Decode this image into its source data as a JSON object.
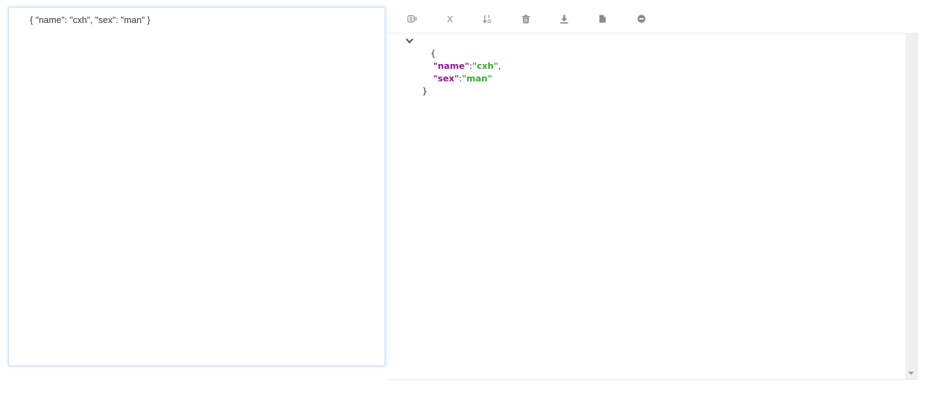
{
  "input": {
    "text": "{ \"name\": \"cxh\", \"sex\": \"man\" }"
  },
  "toolbar": {
    "buttons": [
      {
        "icon": "format-icon"
      },
      {
        "icon": "close-x-icon",
        "label": "X"
      },
      {
        "icon": "sort-icon"
      },
      {
        "icon": "trash-icon"
      },
      {
        "icon": "download-icon"
      },
      {
        "icon": "file-icon"
      },
      {
        "icon": "minus-circle-icon"
      }
    ]
  },
  "viewer": {
    "open_brace": "{",
    "close_brace": "}",
    "pairs": [
      {
        "key": "\"name\"",
        "sep": ":",
        "value": "\"cxh\"",
        "comma": ","
      },
      {
        "key": "\"sex\"",
        "sep": ":",
        "value": "\"man\"",
        "comma": ""
      }
    ]
  },
  "colors": {
    "key": "#8b1c8b",
    "string": "#3aa83a",
    "icon": "#8a8a8a",
    "panel_border": "#cfe3f7"
  }
}
